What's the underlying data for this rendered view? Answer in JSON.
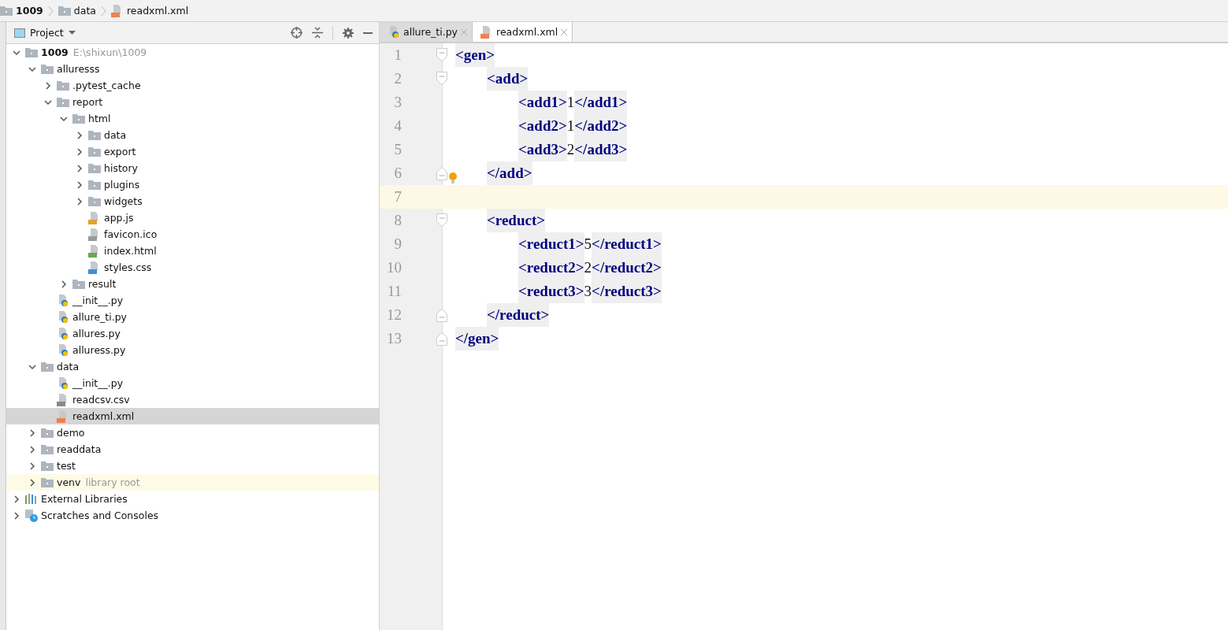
{
  "breadcrumbs": [
    {
      "label": "1009",
      "kind": "folder",
      "bold": true
    },
    {
      "label": "data",
      "kind": "folder",
      "bold": false
    },
    {
      "label": "readxml.xml",
      "kind": "xml",
      "bold": false
    }
  ],
  "project_panel": {
    "title": "Project",
    "tree": [
      {
        "label": "1009",
        "kind": "folder",
        "bold": true,
        "hint": "E:\\shixun\\1009",
        "expanded": true,
        "selected": false,
        "children": [
          {
            "label": "alluresss",
            "kind": "folder",
            "bold": false,
            "expanded": true,
            "selected": false,
            "children": [
              {
                "label": ".pytest_cache",
                "kind": "folder",
                "bold": false,
                "expanded": false,
                "selected": false
              },
              {
                "label": "report",
                "kind": "folder",
                "bold": false,
                "expanded": true,
                "selected": false,
                "children": [
                  {
                    "label": "html",
                    "kind": "folder",
                    "bold": false,
                    "expanded": true,
                    "selected": false,
                    "children": [
                      {
                        "label": "data",
                        "kind": "folder",
                        "bold": false,
                        "expanded": false,
                        "selected": false
                      },
                      {
                        "label": "export",
                        "kind": "folder",
                        "bold": false,
                        "expanded": false,
                        "selected": false
                      },
                      {
                        "label": "history",
                        "kind": "folder",
                        "bold": false,
                        "expanded": false,
                        "selected": false
                      },
                      {
                        "label": "plugins",
                        "kind": "folder",
                        "bold": false,
                        "expanded": false,
                        "selected": false
                      },
                      {
                        "label": "widgets",
                        "kind": "folder",
                        "bold": false,
                        "expanded": false,
                        "selected": false
                      },
                      {
                        "label": "app.js",
                        "kind": "js",
                        "bold": false,
                        "selected": false
                      },
                      {
                        "label": "favicon.ico",
                        "kind": "file",
                        "bold": false,
                        "selected": false
                      },
                      {
                        "label": "index.html",
                        "kind": "html",
                        "bold": false,
                        "selected": false
                      },
                      {
                        "label": "styles.css",
                        "kind": "css",
                        "bold": false,
                        "selected": false
                      }
                    ]
                  },
                  {
                    "label": "result",
                    "kind": "folder",
                    "bold": false,
                    "expanded": false,
                    "selected": false
                  }
                ]
              },
              {
                "label": "__init__.py",
                "kind": "py",
                "bold": false,
                "selected": false
              },
              {
                "label": "allure_ti.py",
                "kind": "py",
                "bold": false,
                "selected": false
              },
              {
                "label": "allures.py",
                "kind": "py",
                "bold": false,
                "selected": false
              },
              {
                "label": "alluress.py",
                "kind": "py",
                "bold": false,
                "selected": false
              }
            ]
          },
          {
            "label": "data",
            "kind": "folder",
            "bold": false,
            "expanded": true,
            "selected": false,
            "children": [
              {
                "label": "__init__.py",
                "kind": "py",
                "bold": false,
                "selected": false
              },
              {
                "label": "readcsv.csv",
                "kind": "csv",
                "bold": false,
                "selected": false
              },
              {
                "label": "readxml.xml",
                "kind": "xml",
                "bold": false,
                "selected": true
              }
            ]
          },
          {
            "label": "demo",
            "kind": "folder",
            "bold": false,
            "expanded": false,
            "selected": false
          },
          {
            "label": "readdata",
            "kind": "folder",
            "bold": false,
            "expanded": false,
            "selected": false
          },
          {
            "label": "test",
            "kind": "folder",
            "bold": false,
            "expanded": false,
            "selected": false
          },
          {
            "label": "venv",
            "kind": "folder",
            "bold": false,
            "hint": "library root",
            "highlighted": true,
            "expanded": false,
            "selected": false
          }
        ]
      },
      {
        "label": "External Libraries",
        "kind": "libraries",
        "bold": false,
        "expanded": false,
        "selected": false
      },
      {
        "label": "Scratches and Consoles",
        "kind": "scratches",
        "bold": false,
        "expanded": false,
        "selected": false
      }
    ]
  },
  "tabs": [
    {
      "label": "allure_ti.py",
      "kind": "py",
      "selected": false
    },
    {
      "label": "readxml.xml",
      "kind": "xml",
      "selected": true
    }
  ],
  "editor": {
    "lines": [
      {
        "number": "1",
        "fold_start": true,
        "fold_end": false,
        "current": false,
        "bulb": false,
        "segments": [
          {
            "kind": "tag",
            "text": "<gen>"
          }
        ],
        "children": [
          {
            "number": "2",
            "fold_start": true,
            "fold_end": false,
            "current": false,
            "bulb": false,
            "segments": [
              {
                "kind": "tag",
                "text": "<add>"
              }
            ],
            "children": [
              {
                "number": "3",
                "fold_start": false,
                "fold_end": false,
                "current": false,
                "bulb": false,
                "segments": [
                  {
                    "kind": "tag",
                    "text": "<add1>"
                  },
                  {
                    "kind": "text",
                    "text": "1"
                  },
                  {
                    "kind": "tag",
                    "text": "</add1>"
                  }
                ]
              },
              {
                "number": "4",
                "fold_start": false,
                "fold_end": false,
                "current": false,
                "bulb": false,
                "segments": [
                  {
                    "kind": "tag",
                    "text": "<add2>"
                  },
                  {
                    "kind": "text",
                    "text": "1"
                  },
                  {
                    "kind": "tag",
                    "text": "</add2>"
                  }
                ]
              },
              {
                "number": "5",
                "fold_start": false,
                "fold_end": false,
                "current": false,
                "bulb": false,
                "segments": [
                  {
                    "kind": "tag",
                    "text": "<add3>"
                  },
                  {
                    "kind": "text",
                    "text": "2"
                  },
                  {
                    "kind": "tag",
                    "text": "</add3>"
                  }
                ]
              }
            ]
          },
          {
            "number": "6",
            "fold_start": false,
            "fold_end": true,
            "current": false,
            "bulb": true,
            "segments": [
              {
                "kind": "tag",
                "text": "</add>"
              }
            ]
          },
          {
            "number": "7",
            "fold_start": false,
            "fold_end": false,
            "current": true,
            "bulb": false
          },
          {
            "number": "8",
            "fold_start": true,
            "fold_end": false,
            "current": false,
            "bulb": false,
            "segments": [
              {
                "kind": "tag",
                "text": "<reduct>"
              }
            ],
            "children": [
              {
                "number": "9",
                "fold_start": false,
                "fold_end": false,
                "current": false,
                "bulb": false,
                "segments": [
                  {
                    "kind": "tag",
                    "text": "<reduct1>"
                  },
                  {
                    "kind": "text",
                    "text": "5"
                  },
                  {
                    "kind": "tag",
                    "text": "</reduct1>"
                  }
                ]
              },
              {
                "number": "10",
                "fold_start": false,
                "fold_end": false,
                "current": false,
                "bulb": false,
                "segments": [
                  {
                    "kind": "tag",
                    "text": "<reduct2>"
                  },
                  {
                    "kind": "text",
                    "text": "2"
                  },
                  {
                    "kind": "tag",
                    "text": "</reduct2>"
                  }
                ]
              },
              {
                "number": "11",
                "fold_start": false,
                "fold_end": false,
                "current": false,
                "bulb": false,
                "segments": [
                  {
                    "kind": "tag",
                    "text": "<reduct3>"
                  },
                  {
                    "kind": "text",
                    "text": "3"
                  },
                  {
                    "kind": "tag",
                    "text": "</reduct3>"
                  }
                ]
              }
            ]
          },
          {
            "number": "12",
            "fold_start": false,
            "fold_end": true,
            "current": false,
            "bulb": false,
            "segments": [
              {
                "kind": "tag",
                "text": "</reduct>"
              }
            ]
          }
        ]
      },
      {
        "number": "13",
        "fold_start": false,
        "fold_end": true,
        "current": false,
        "bulb": false,
        "segments": [
          {
            "kind": "tag",
            "text": "</gen>"
          }
        ]
      }
    ]
  }
}
